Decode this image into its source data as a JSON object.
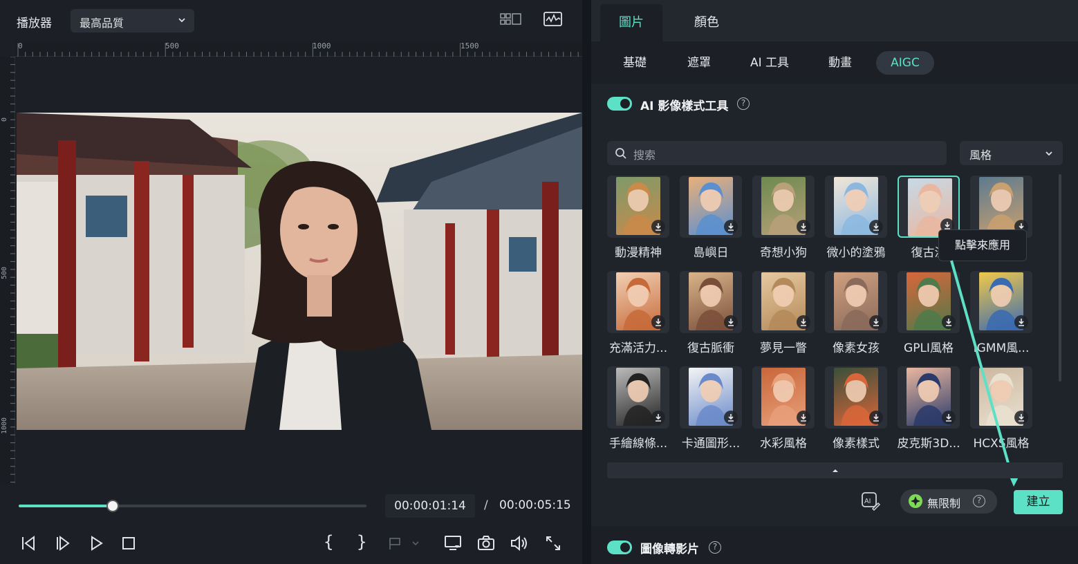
{
  "player": {
    "title": "播放器",
    "quality": "最高品質",
    "ruler_h_labels": [
      "0",
      "500",
      "1000",
      "1500"
    ],
    "ruler_v_labels": [
      "0",
      "500",
      "1000"
    ],
    "time_current": "00:00:01:14",
    "time_separator": "/",
    "time_total": "00:00:05:15",
    "progress_fraction": 0.27,
    "mark_in": "{",
    "mark_out": "}"
  },
  "panel": {
    "main_tabs": [
      {
        "label": "圖片",
        "active": true
      },
      {
        "label": "顏色",
        "active": false
      }
    ],
    "sub_tabs": [
      {
        "label": "基礎",
        "active": false
      },
      {
        "label": "遮罩",
        "active": false
      },
      {
        "label": "AI 工具",
        "active": false
      },
      {
        "label": "動畫",
        "active": false
      },
      {
        "label": "AIGC",
        "active": true
      }
    ],
    "section_title": "AI 影像樣式工具",
    "search_placeholder": "搜索",
    "style_filter": "風格",
    "styles": [
      {
        "label": "動漫精神"
      },
      {
        "label": "島嶼日"
      },
      {
        "label": "奇想小狗"
      },
      {
        "label": "微小的塗鴉"
      },
      {
        "label": "復古漫",
        "selected": true
      },
      {
        "label": ""
      },
      {
        "label": "充滿活力..."
      },
      {
        "label": "復古脈衝"
      },
      {
        "label": "夢見一瞥"
      },
      {
        "label": "像素女孩"
      },
      {
        "label": "GPLI風格"
      },
      {
        "label": "IGMM風..."
      },
      {
        "label": "手繪線條..."
      },
      {
        "label": "卡通圖形..."
      },
      {
        "label": "水彩風格"
      },
      {
        "label": "像素樣式"
      },
      {
        "label": "皮克斯3D..."
      },
      {
        "label": "HCXS風格"
      }
    ],
    "tooltip": "點擊來應用",
    "unlimited_label": "無限制",
    "create_label": "建立",
    "section2_title": "圖像轉影片",
    "accent_color": "#5ce0c6"
  }
}
